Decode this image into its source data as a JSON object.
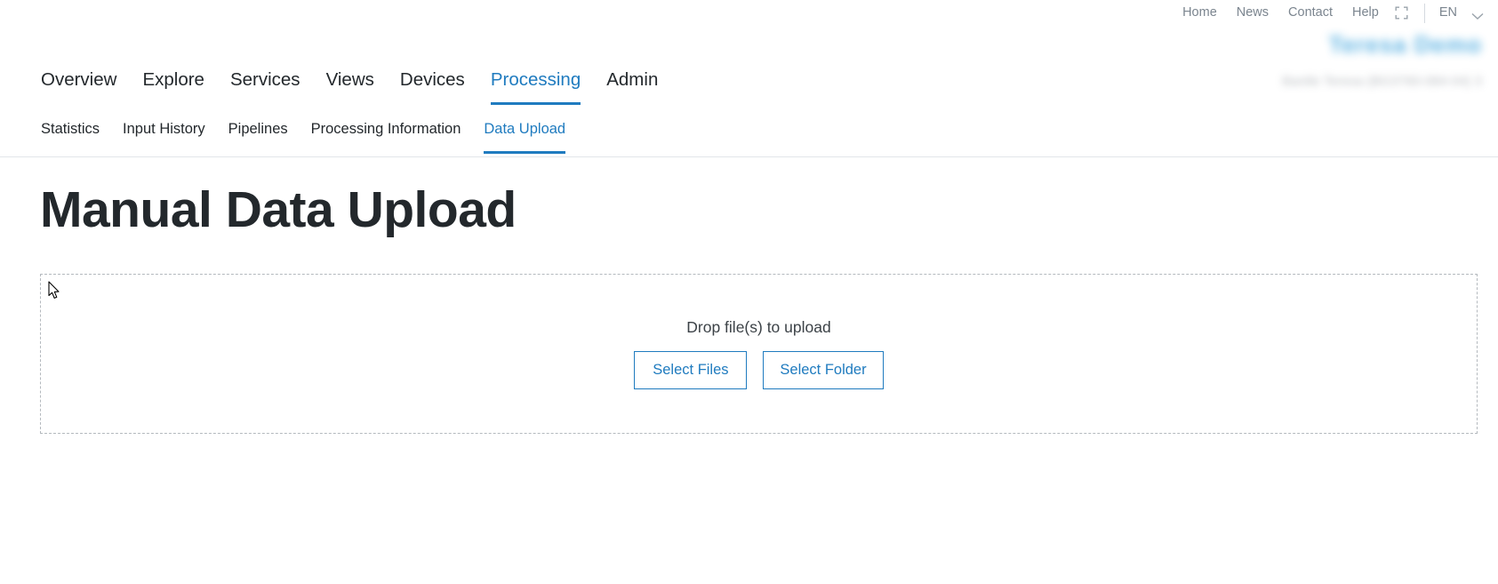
{
  "utility_bar": {
    "links": [
      {
        "label": "Home",
        "name": "utility-link-home"
      },
      {
        "label": "News",
        "name": "utility-link-news"
      },
      {
        "label": "Contact",
        "name": "utility-link-contact"
      },
      {
        "label": "Help",
        "name": "utility-link-help"
      }
    ],
    "fullscreen_icon": "fullscreen-icon",
    "language": {
      "selected": "EN",
      "chevron_icon": "chevron-down-icon"
    }
  },
  "brand": {
    "title": "Teresa Demo",
    "subtitle": "Bantle Teresa (BG3760-084-04) 3"
  },
  "main_nav": {
    "items": [
      {
        "label": "Overview",
        "active": false
      },
      {
        "label": "Explore",
        "active": false
      },
      {
        "label": "Services",
        "active": false
      },
      {
        "label": "Views",
        "active": false
      },
      {
        "label": "Devices",
        "active": false
      },
      {
        "label": "Processing",
        "active": true
      },
      {
        "label": "Admin",
        "active": false
      }
    ]
  },
  "sub_nav": {
    "items": [
      {
        "label": "Statistics",
        "active": false
      },
      {
        "label": "Input History",
        "active": false
      },
      {
        "label": "Pipelines",
        "active": false
      },
      {
        "label": "Processing Information",
        "active": false
      },
      {
        "label": "Data Upload",
        "active": true
      }
    ]
  },
  "main": {
    "page_title": "Manual Data Upload",
    "dropzone": {
      "instruction": "Drop file(s) to upload",
      "select_files_label": "Select Files",
      "select_folder_label": "Select Folder"
    }
  },
  "colors": {
    "accent": "#1f7bbf",
    "text": "#23282c",
    "muted": "#7b858f",
    "border_dashed": "#b4b9be",
    "brand": "#2196d8"
  }
}
